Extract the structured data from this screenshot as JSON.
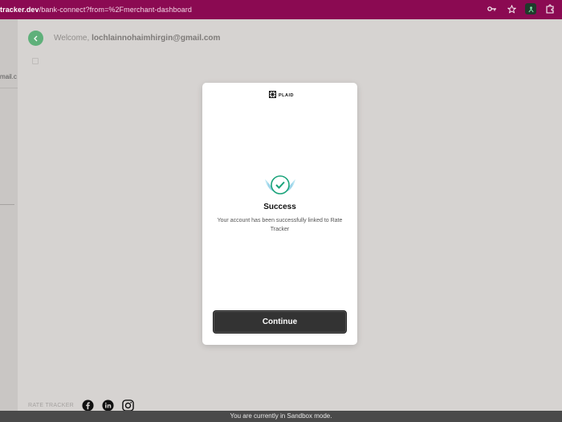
{
  "browser": {
    "url_host": "tracker.dev",
    "url_path": "/bank-connect?from=%2Fmerchant-dashboard"
  },
  "sidebar": {
    "email_fragment": "mail.c"
  },
  "header": {
    "welcome_prefix": "Welcome,",
    "email": "lochlainnohaimhirgin@gmail.com"
  },
  "modal": {
    "brand": "PLAID",
    "title": "Success",
    "description": "Your account has been successfully linked to Rate Tracker",
    "continue_label": "Continue"
  },
  "footer": {
    "brand": "RATE TRACKER",
    "social": [
      "facebook-icon",
      "linkedin-icon",
      "instagram-icon"
    ]
  },
  "banner": {
    "text": "You are currently in Sandbox mode."
  },
  "colors": {
    "browser_bar": "#8b0a52",
    "accent_green": "#5fb07a",
    "button_dark": "#333333",
    "success_teal": "#1aa37a"
  }
}
